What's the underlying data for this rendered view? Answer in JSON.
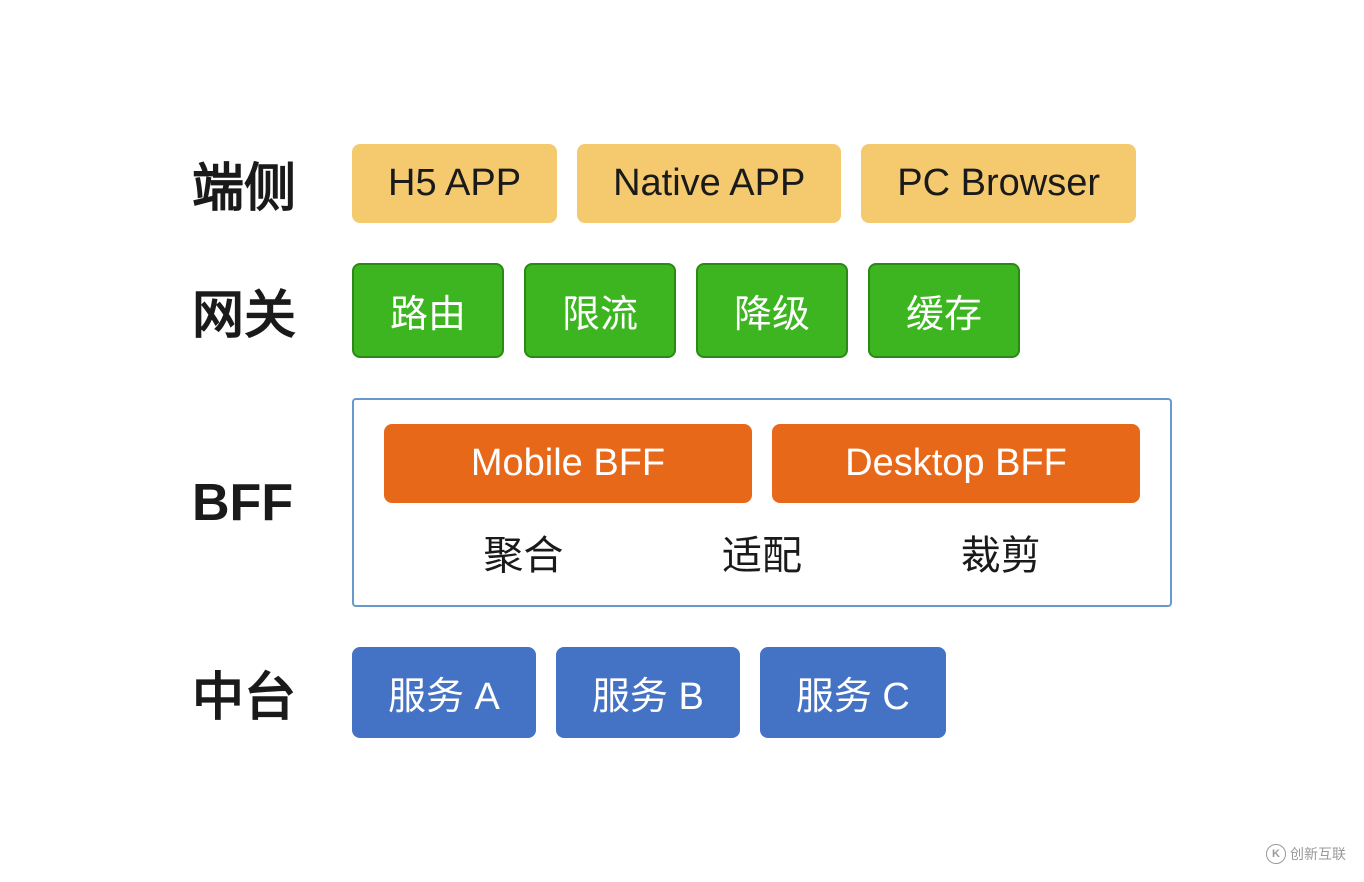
{
  "rows": [
    {
      "id": "client-row",
      "label": "端侧",
      "type": "badges-orange",
      "items": [
        "H5 APP",
        "Native APP",
        "PC Browser"
      ]
    },
    {
      "id": "gateway-row",
      "label": "网关",
      "type": "badges-green",
      "items": [
        "路由",
        "限流",
        "降级",
        "缓存"
      ]
    },
    {
      "id": "bff-row",
      "label": "BFF",
      "type": "bff",
      "top_items": [
        "Mobile BFF",
        "Desktop BFF"
      ],
      "bottom_items": [
        "聚合",
        "适配",
        "裁剪"
      ]
    },
    {
      "id": "platform-row",
      "label": "中台",
      "type": "badges-blue",
      "items": [
        "服务 A",
        "服务 B",
        "服务 C"
      ]
    }
  ],
  "watermark": {
    "symbol": "K",
    "text": "创新互联"
  }
}
